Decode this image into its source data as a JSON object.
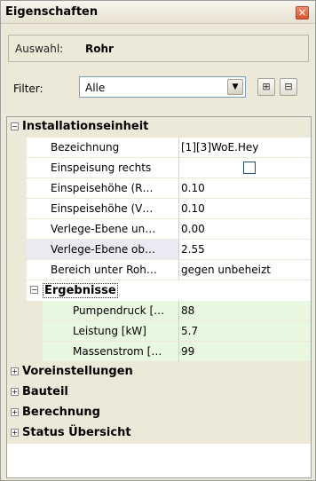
{
  "window": {
    "title": "Eigenschaften"
  },
  "selection": {
    "label": "Auswahl:",
    "value": "Rohr"
  },
  "filter": {
    "label": "Filter:",
    "value": "Alle"
  },
  "categories": [
    {
      "label": "Installationseinheit",
      "toggle": "⊟",
      "rows": [
        {
          "name": "Bezeichnung",
          "value": "[1][3]WoE.Hey"
        },
        {
          "name": "Einspeisung rechts",
          "value": ""
        },
        {
          "name": "Einspeisehöhe (R…",
          "value": "0.10"
        },
        {
          "name": "Einspeisehöhe (V…",
          "value": "0.10"
        },
        {
          "name": "Verlege-Ebene un…",
          "value": "0.00"
        },
        {
          "name": "Verlege-Ebene ob…",
          "value": "2.55"
        },
        {
          "name": "Bereich unter Roh…",
          "value": "gegen unbeheizt"
        }
      ],
      "subgroup": {
        "label": "Ergebnisse",
        "rows": [
          {
            "name": "Pumpendruck […",
            "value": "88"
          },
          {
            "name": "Leistung [kW]",
            "value": "5.7"
          },
          {
            "name": "Massenstrom […",
            "value": "99"
          }
        ]
      }
    },
    {
      "label": "Voreinstellungen",
      "toggle": "⊞"
    },
    {
      "label": "Bauteil",
      "toggle": "⊞"
    },
    {
      "label": "Berechnung",
      "toggle": "⊞"
    },
    {
      "label": "Status Übersicht",
      "toggle": "⊞"
    }
  ],
  "colors": {
    "accent": "#e8f7e0",
    "close": "#d9532f"
  }
}
